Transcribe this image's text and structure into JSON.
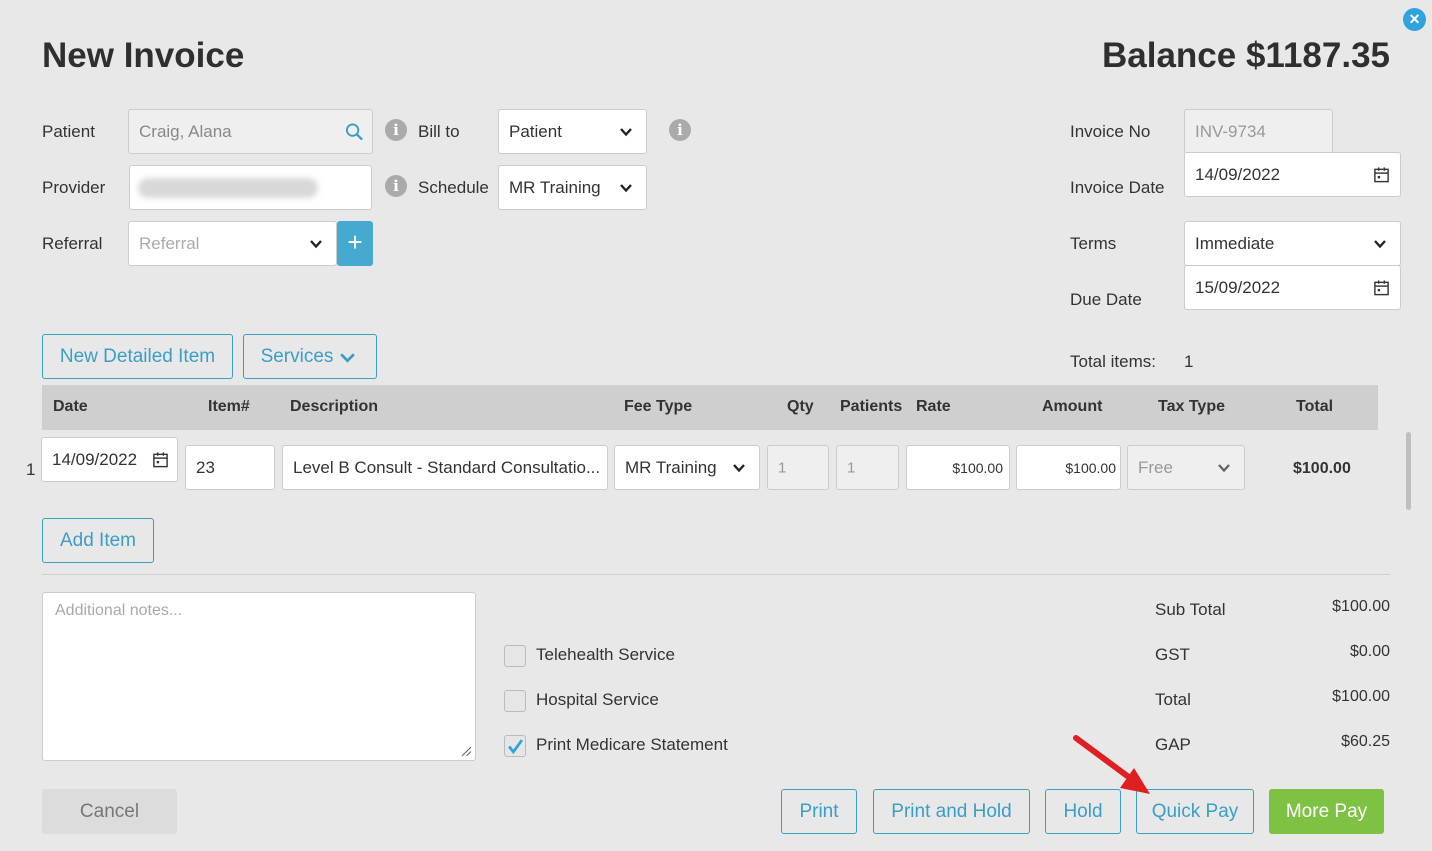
{
  "header": {
    "title": "New Invoice",
    "balance": "Balance $1187.35"
  },
  "close": "×",
  "form": {
    "patient_label": "Patient",
    "patient_value": "Craig, Alana",
    "bill_to_label": "Bill to",
    "bill_to_value": "Patient",
    "provider_label": "Provider",
    "provider_value": "",
    "schedule_label": "Schedule",
    "schedule_value": "MR Training",
    "referral_label": "Referral",
    "referral_placeholder": "Referral",
    "referral_add": "+",
    "invoice_no_label": "Invoice No",
    "invoice_no_value": "INV-9734",
    "invoice_date_label": "Invoice Date",
    "invoice_date_value": "14/09/2022",
    "terms_label": "Terms",
    "terms_value": "Immediate",
    "due_date_label": "Due Date",
    "due_date_value": "15/09/2022",
    "info_icon": "i"
  },
  "items_toolbar": {
    "new_detailed_item": "New Detailed Item",
    "services": "Services"
  },
  "total_items": {
    "label": "Total items:",
    "value": "1"
  },
  "table": {
    "headers": [
      "Date",
      "Item#",
      "Description",
      "Fee Type",
      "Qty",
      "Patients",
      "Rate",
      "Amount",
      "Tax Type",
      "Total"
    ],
    "rows": [
      {
        "num": "1",
        "date": "14/09/2022",
        "item": "23",
        "description": "Level B Consult - Standard Consultatio...",
        "fee_type": "MR Training",
        "qty": "1",
        "patients": "1",
        "rate": "$100.00",
        "amount": "$100.00",
        "tax_type": "Free",
        "total": "$100.00"
      }
    ]
  },
  "add_item": "Add Item",
  "notes_placeholder": "Additional notes...",
  "checkboxes": [
    {
      "label": "Telehealth Service",
      "checked": false
    },
    {
      "label": "Hospital Service",
      "checked": false
    },
    {
      "label": "Print Medicare Statement",
      "checked": true
    }
  ],
  "summary": {
    "sub_total_label": "Sub Total",
    "sub_total": "$100.00",
    "gst_label": "GST",
    "gst": "$0.00",
    "total_label": "Total",
    "total": "$100.00",
    "gap_label": "GAP",
    "gap": "$60.25"
  },
  "footer": {
    "cancel": "Cancel",
    "print": "Print",
    "print_and_hold": "Print and Hold",
    "hold": "Hold",
    "quick_pay": "Quick Pay",
    "more_pay": "More Pay"
  },
  "colors": {
    "accent": "#3a9ec5",
    "green": "#7dc242",
    "arrow": "#e02020"
  }
}
